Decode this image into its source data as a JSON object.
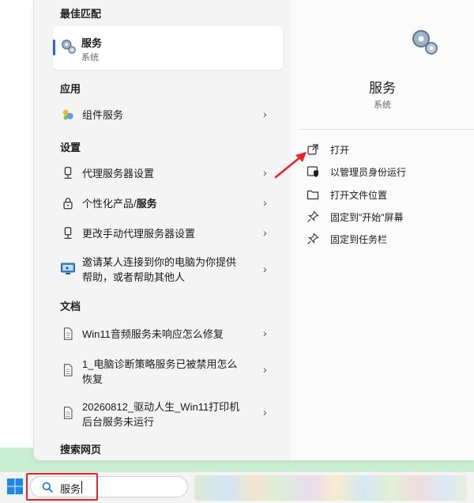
{
  "sections": {
    "best_match": "最佳匹配",
    "apps": "应用",
    "settings": "设置",
    "documents": "文档",
    "web": "搜索网页"
  },
  "best_match": {
    "title": "服务",
    "subtitle": "系统",
    "icon": "gears-icon"
  },
  "apps": [
    {
      "label": "组件服务",
      "icon": "component-services-icon"
    }
  ],
  "settings": [
    {
      "label": "代理服务器设置",
      "icon": "proxy-icon"
    },
    {
      "label_prefix": "个性化产品/",
      "label_bold": "服务",
      "icon": "lock-icon"
    },
    {
      "label": "更改手动代理服务器设置",
      "icon": "proxy-icon"
    },
    {
      "label_line1": "邀请某人连接到你的电脑为你提供",
      "label_line2": "帮助，或者帮助其他人",
      "icon": "remote-assist-icon"
    }
  ],
  "documents": [
    {
      "label": "Win11音频服务未响应怎么修复",
      "icon": "document-icon"
    },
    {
      "label_line1": "1_电脑诊断策略服务已被禁用怎么",
      "label_line2": "恢复",
      "icon": "document-icon"
    },
    {
      "label_line1": "20260812_驱动人生_Win11打印机",
      "label_line2": "后台服务未运行",
      "icon": "document-icon"
    }
  ],
  "detail": {
    "title": "服务",
    "subtitle": "系统"
  },
  "actions": [
    {
      "label": "打开",
      "icon": "open-icon"
    },
    {
      "label": "以管理员身份运行",
      "icon": "admin-shield-icon"
    },
    {
      "label": "打开文件位置",
      "icon": "folder-icon"
    },
    {
      "label": "固定到\"开始\"屏幕",
      "icon": "pin-icon"
    },
    {
      "label": "固定到任务栏",
      "icon": "pin-icon"
    }
  ],
  "search": {
    "value": "服务"
  },
  "colors": {
    "accent": "#1a6fc9",
    "highlight": "#e8242a"
  }
}
